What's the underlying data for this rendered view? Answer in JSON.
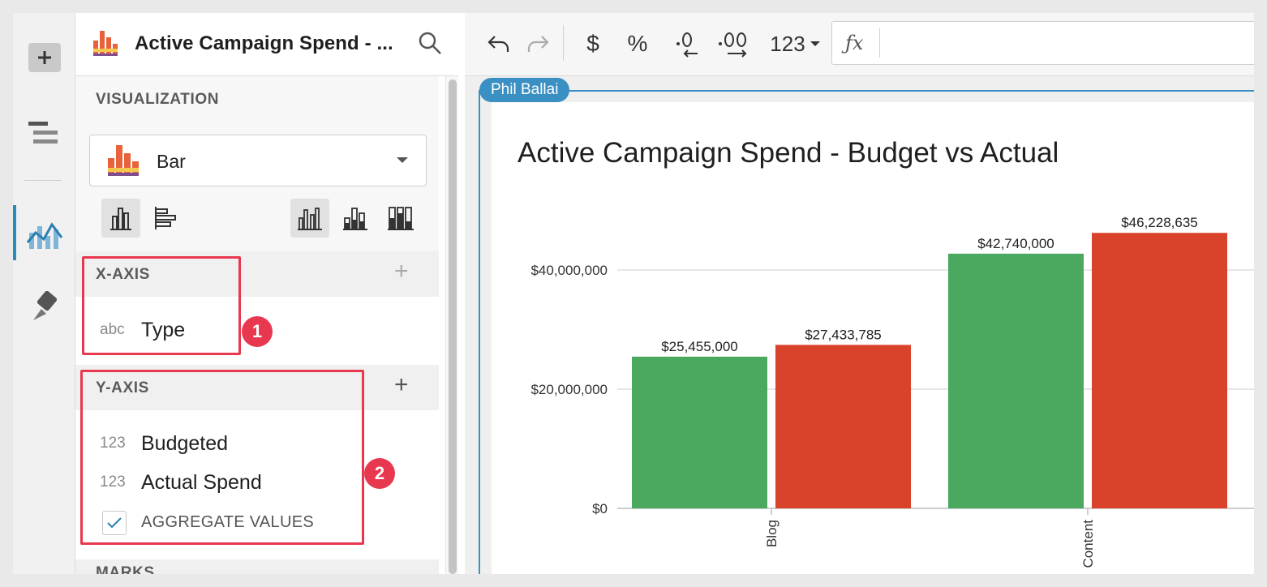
{
  "header": {
    "title": "Active Campaign Spend - ..."
  },
  "panel": {
    "visualization_label": "VISUALIZATION",
    "chart_type": "Bar",
    "x_axis_label": "X-AXIS",
    "x_fields": [
      {
        "type": "abc",
        "name": "Type"
      }
    ],
    "y_axis_label": "Y-AXIS",
    "y_fields": [
      {
        "type": "123",
        "name": "Budgeted"
      },
      {
        "type": "123",
        "name": "Actual Spend"
      }
    ],
    "aggregate_label": "AGGREGATE VALUES",
    "aggregate_checked": true,
    "marks_label": "MARKS"
  },
  "callouts": [
    "1",
    "2"
  ],
  "toolbar": {
    "currency": "$",
    "percent": "%",
    "number_format": "123"
  },
  "canvas": {
    "user_tag": "Phil Ballai"
  },
  "chart_data": {
    "type": "bar",
    "title": "Active Campaign Spend - Budget vs Actual",
    "categories": [
      "Blog",
      "Content"
    ],
    "series": [
      {
        "values": [
          25455000,
          42740000
        ],
        "labels": [
          "$25,455,000",
          "$42,740,000"
        ],
        "color": "#4aa85f"
      },
      {
        "values": [
          27433785,
          46228635
        ],
        "labels": [
          "$27,433,785",
          "$46,228,635"
        ],
        "color": "#d9432b"
      }
    ],
    "yticks": [
      0,
      20000000,
      40000000
    ],
    "ytick_labels": [
      "$0",
      "$20,000,000",
      "$40,000,000"
    ],
    "ylim": [
      0,
      50000000
    ],
    "grid": true
  },
  "colors": {
    "accent": "#3a8fc3",
    "callout": "#e8384f"
  }
}
